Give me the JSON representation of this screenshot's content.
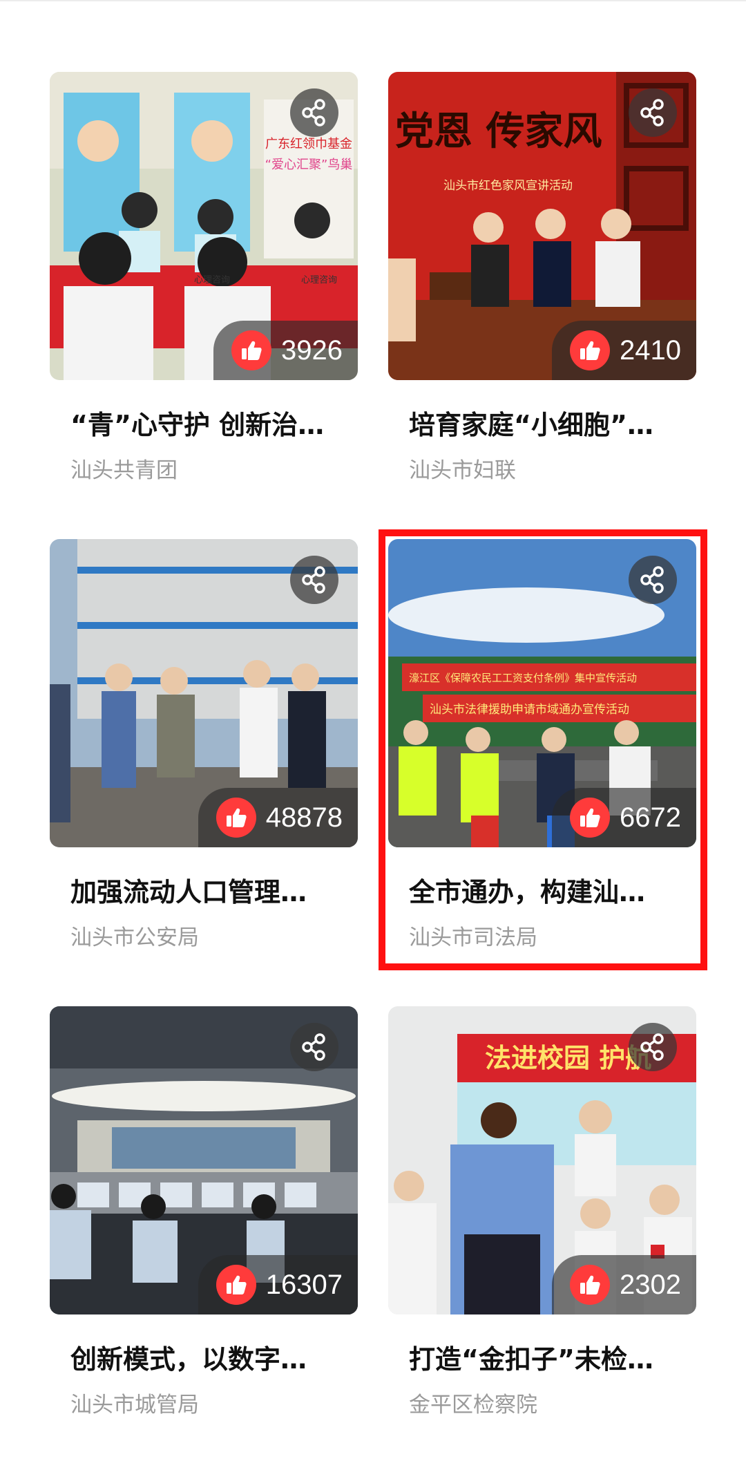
{
  "cards": [
    {
      "title": "“青”心守护 创新治…",
      "source": "汕头共青团",
      "likes": "3926",
      "image_text": [
        "广东红领巾基金",
        "“爱心汇聚”鸟巢",
        "心理咨询",
        "心理咨询"
      ]
    },
    {
      "title": "培育家庭“小细胞”…",
      "source": "汕头市妇联",
      "likes": "2410",
      "image_text": [
        "党恩 传家风",
        "汕头市红色家风宣讲活动"
      ]
    },
    {
      "title": "加强流动人口管理…",
      "source": "汕头市公安局",
      "likes": "48878",
      "image_text": []
    },
    {
      "title": "全市通办，构建汕…",
      "source": "汕头市司法局",
      "likes": "6672",
      "image_text": [
        "濠江区《保障农民工工资支付条例》集中宣传活动",
        "汕头市法律援助申请市域通办宣传活动"
      ]
    },
    {
      "title": "创新模式，以数字…",
      "source": "汕头市城管局",
      "likes": "16307",
      "image_text": []
    },
    {
      "title": "打造“金扣子”未检…",
      "source": "金平区检察院",
      "likes": "2302",
      "image_text": [
        "法进校园 护航"
      ]
    }
  ],
  "colors": {
    "like": "#ff3b3b",
    "highlight": "#ff1111"
  },
  "icons": {
    "share": "share-icon",
    "like": "thumbs-up-icon"
  }
}
